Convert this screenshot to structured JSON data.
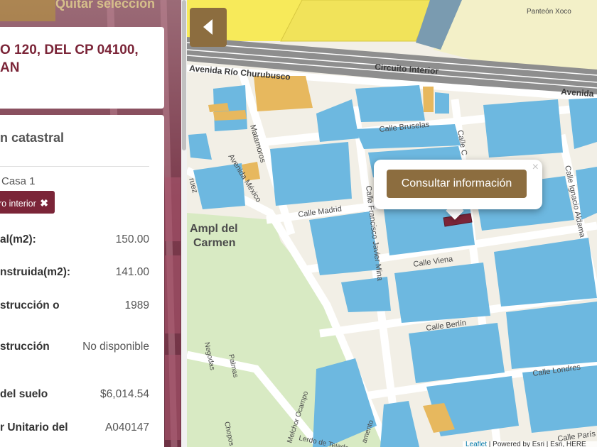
{
  "sidebar": {
    "clear_selection_label": "Quitar selección",
    "address": "O 120, DEL CP 04100, AN",
    "info_card": {
      "title": "n catastral",
      "casa_label": "Casa 1",
      "filter_chip_label": "ro interior",
      "filter_chip_close": "✖",
      "rows": [
        {
          "label": "al(m2):",
          "value": "150.00"
        },
        {
          "label": "nstruida(m2):",
          "value": "141.00"
        },
        {
          "label": "strucción o",
          "value": "1989"
        },
        {
          "label": "strucción",
          "value": "No disponible"
        },
        {
          "label": "del suelo",
          "value": "$6,014.54"
        },
        {
          "label": "r Unitario del",
          "value": "A040147"
        }
      ]
    }
  },
  "map": {
    "collapse_icon": "chevron-left-icon",
    "labels": {
      "panteon": "Panteón Xoco",
      "av_rio": "Avenida Río Churubusco",
      "circuito": "Circuito Interior",
      "avenida": "Avenida",
      "bruselas": "Calle Bruselas",
      "matamoros": "Matamoros",
      "av_mexico": "Avenida México",
      "madrid": "Calle Madrid",
      "francisco": "Calle Francisco Javier Mina",
      "viena": "Calle Viena",
      "berlin": "Calle Berlín",
      "londres": "Calle Londres",
      "paris": "Calle París",
      "ignacio": "Calle Ignacio Aldama",
      "calle_c": "Calle C",
      "rodriguez": "ruez",
      "ampl1": "Ampl del",
      "ampl2": "Carmen",
      "negodas": "Negodas",
      "palmas": "Palmas",
      "chopos": "Chopos",
      "ocampo": "Melchor Ocampo",
      "lerdo": "Lerdo de Tejada",
      "amento": "amento"
    },
    "popup": {
      "button_label": "Consultar información",
      "close_label": "×"
    },
    "attribution": {
      "leaflet": "Leaflet",
      "rest": " | Powered by Esri | Esri, HERE"
    },
    "colors": {
      "building": "#6db8e0",
      "commercial": "#e7b85e",
      "park": "#d8eac3",
      "yellow_zone": "#f7ea5a",
      "selected_parcel": "#7b2538",
      "accent": "#8c6d3f"
    }
  }
}
